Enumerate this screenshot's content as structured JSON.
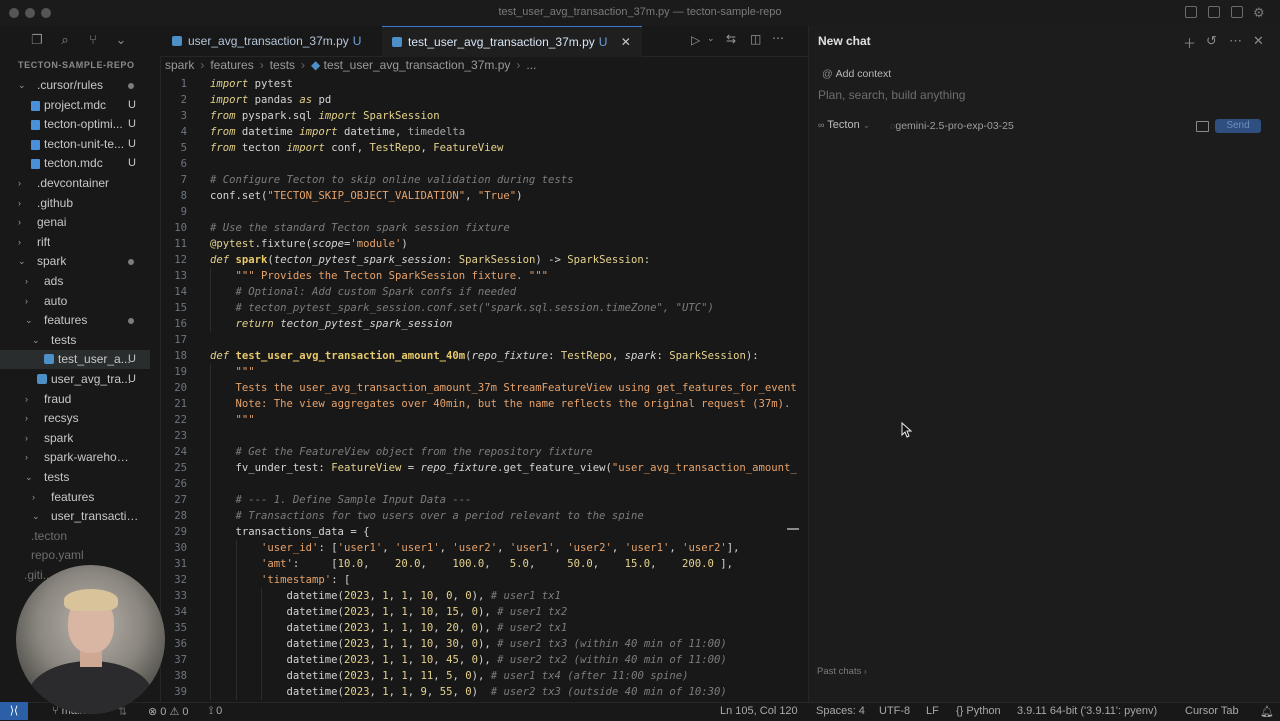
{
  "window": {
    "title": "test_user_avg_transaction_37m.py — tecton-sample-repo"
  },
  "sidebar": {
    "repo_title": "TECTON-SAMPLE-REPO",
    "items": [
      {
        "label": ".cursor/rules",
        "badge": "",
        "indent": 0,
        "type": "folder-open"
      },
      {
        "label": "project.mdc",
        "badge": "U",
        "indent": 1,
        "type": "file"
      },
      {
        "label": "tecton-optimi...",
        "badge": "U",
        "indent": 1,
        "type": "file"
      },
      {
        "label": "tecton-unit-te...",
        "badge": "U",
        "indent": 1,
        "type": "file"
      },
      {
        "label": "tecton.mdc",
        "badge": "U",
        "indent": 1,
        "type": "file"
      },
      {
        "label": ".devcontainer",
        "badge": "",
        "indent": 0,
        "type": "folder"
      },
      {
        "label": ".github",
        "badge": "",
        "indent": 0,
        "type": "folder"
      },
      {
        "label": "genai",
        "badge": "",
        "indent": 0,
        "type": "folder"
      },
      {
        "label": "rift",
        "badge": "",
        "indent": 0,
        "type": "folder"
      },
      {
        "label": "spark",
        "badge": "",
        "indent": 0,
        "type": "folder-open"
      },
      {
        "label": "ads",
        "badge": "",
        "indent": 1,
        "type": "folder"
      },
      {
        "label": "auto",
        "badge": "",
        "indent": 1,
        "type": "folder"
      },
      {
        "label": "features",
        "badge": "",
        "indent": 1,
        "type": "folder-open"
      },
      {
        "label": "tests",
        "badge": "",
        "indent": 2,
        "type": "folder-open"
      },
      {
        "label": "test_user_a...",
        "badge": "U",
        "indent": 3,
        "type": "py"
      },
      {
        "label": "user_avg_tra...",
        "badge": "U",
        "indent": 2,
        "type": "py"
      },
      {
        "label": "fraud",
        "badge": "",
        "indent": 1,
        "type": "folder"
      },
      {
        "label": "recsys",
        "badge": "",
        "indent": 1,
        "type": "folder"
      },
      {
        "label": "spark",
        "badge": "",
        "indent": 1,
        "type": "folder"
      },
      {
        "label": "spark-warehouse",
        "badge": "",
        "indent": 1,
        "type": "folder"
      },
      {
        "label": "tests",
        "badge": "",
        "indent": 1,
        "type": "folder-open"
      },
      {
        "label": "features",
        "badge": "",
        "indent": 2,
        "type": "folder"
      },
      {
        "label": "user_transaction_...",
        "badge": "",
        "indent": 2,
        "type": "folder-open"
      },
      {
        "label": ".tecton",
        "badge": "",
        "indent": 1,
        "type": "plain"
      },
      {
        "label": "repo.yaml",
        "badge": "",
        "indent": 1,
        "type": "plain"
      },
      {
        "label": ".giti...",
        "badge": "",
        "indent": 0,
        "type": "plain"
      }
    ]
  },
  "tabs": [
    {
      "label": "user_avg_transaction_37m.py",
      "mod": "U"
    },
    {
      "label": "test_user_avg_transaction_37m.py",
      "mod": "U"
    }
  ],
  "breadcrumb": [
    "spark",
    "features",
    "tests",
    "test_user_avg_transaction_37m.py",
    "..."
  ],
  "chat": {
    "title": "New chat",
    "add_context": "Add context",
    "placeholder": "Plan, search, build anything",
    "mode": "Tecton",
    "model": "gemini-2.5-pro-exp-03-25",
    "send": "Send",
    "past_chats": "Past chats"
  },
  "status": {
    "branch": "main",
    "errors": "0",
    "warnings": "0",
    "ports": "0",
    "position": "Ln 105, Col 120",
    "spaces": "Spaces: 4",
    "encoding": "UTF-8",
    "eol": "LF",
    "language": "Python",
    "interpreter": "3.9.11 64-bit ('3.9.11': pyenv)",
    "cursor_tab": "Cursor Tab"
  }
}
